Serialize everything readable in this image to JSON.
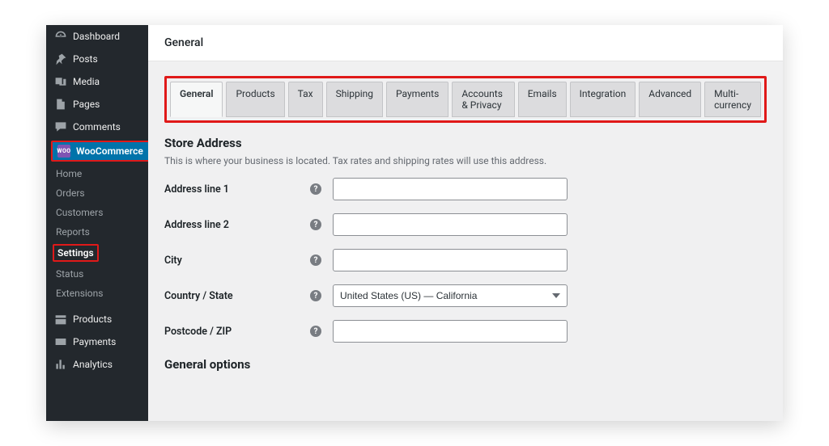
{
  "sidebar": {
    "items": [
      {
        "label": "Dashboard"
      },
      {
        "label": "Posts"
      },
      {
        "label": "Media"
      },
      {
        "label": "Pages"
      },
      {
        "label": "Comments"
      },
      {
        "label": "WooCommerce"
      },
      {
        "label": "Products"
      },
      {
        "label": "Payments"
      },
      {
        "label": "Analytics"
      }
    ],
    "wc_sub": [
      {
        "label": "Home"
      },
      {
        "label": "Orders"
      },
      {
        "label": "Customers"
      },
      {
        "label": "Reports"
      },
      {
        "label": "Settings"
      },
      {
        "label": "Status"
      },
      {
        "label": "Extensions"
      }
    ],
    "wc_badge": "WOO"
  },
  "header": {
    "title": "General"
  },
  "tabs": [
    {
      "label": "General"
    },
    {
      "label": "Products"
    },
    {
      "label": "Tax"
    },
    {
      "label": "Shipping"
    },
    {
      "label": "Payments"
    },
    {
      "label": "Accounts & Privacy"
    },
    {
      "label": "Emails"
    },
    {
      "label": "Integration"
    },
    {
      "label": "Advanced"
    },
    {
      "label": "Multi-currency"
    }
  ],
  "section": {
    "title": "Store Address",
    "desc": "This is where your business is located. Tax rates and shipping rates will use this address.",
    "rows": [
      {
        "label": "Address line 1",
        "value": ""
      },
      {
        "label": "Address line 2",
        "value": ""
      },
      {
        "label": "City",
        "value": ""
      },
      {
        "label": "Country / State",
        "value": "United States (US) — California"
      },
      {
        "label": "Postcode / ZIP",
        "value": ""
      }
    ],
    "second_title": "General options"
  },
  "help_glyph": "?"
}
